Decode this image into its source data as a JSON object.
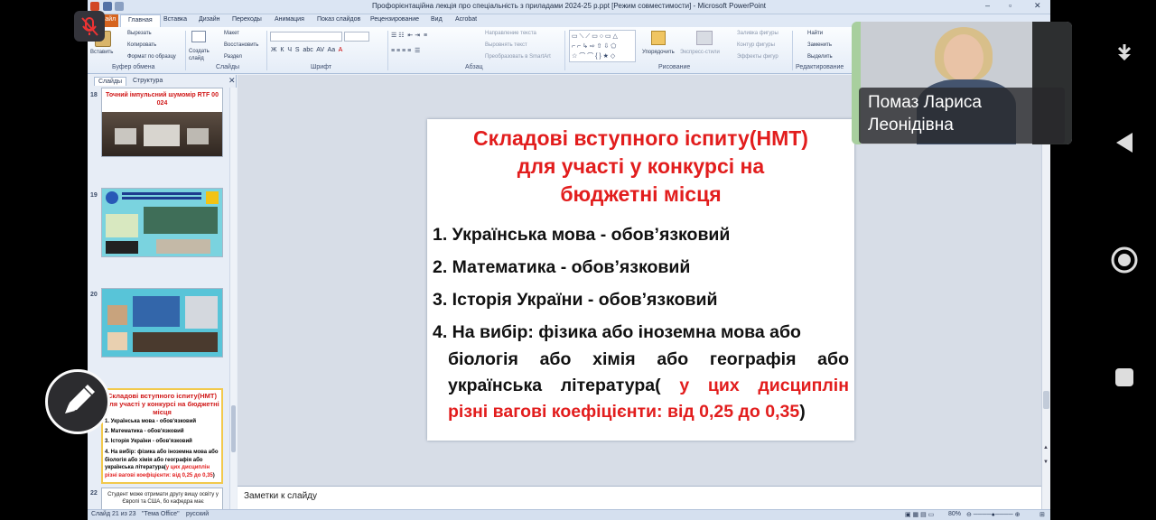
{
  "window": {
    "title": "Профорієнтаційна лекція про  спеціальність з приладами 2024-25 р.ppt [Режим совместимости] - Microsoft PowerPoint"
  },
  "ribbon_tabs": [
    "Файл",
    "Главная",
    "Вставка",
    "Дизайн",
    "Переходы",
    "Анимация",
    "Показ слайдов",
    "Рецензирование",
    "Вид",
    "Acrobat"
  ],
  "ribbon": {
    "clipboard": {
      "paste": "Вставить",
      "cut": "Вырезать",
      "copy": "Копировать",
      "format_painter": "Формат по образцу",
      "label": "Буфер обмена"
    },
    "slides": {
      "new_slide": "Создать слайд",
      "layout": "Макет",
      "reset": "Восстановить",
      "section": "Раздел",
      "label": "Слайды"
    },
    "font": {
      "label": "Шрифт"
    },
    "paragraph": {
      "text_direction": "Направление текста",
      "align_text": "Выровнять текст",
      "smartart": "Преобразовать в SmartArt",
      "label": "Абзац"
    },
    "drawing": {
      "arrange": "Упорядочить",
      "quick_styles": "Экспресс-стили",
      "fill": "Заливка фигуры",
      "outline": "Контур фигуры",
      "effects": "Эффекты фигур",
      "label": "Рисование"
    },
    "editing": {
      "find": "Найти",
      "replace": "Заменить",
      "select": "Выделить",
      "label": "Редактирование"
    }
  },
  "slides_panel": {
    "tabs": [
      "Слайды",
      "Структура"
    ],
    "thumbs": [
      {
        "num": "18",
        "title": "Точний імпульсний шумомір RTF 00 024"
      },
      {
        "num": "19"
      },
      {
        "num": "20"
      },
      {
        "num": "21",
        "title": "Складові вступного іспиту(НМТ) для участі у конкурсі на бюджетні місця",
        "items": [
          "1. Українська мова - обов'язковий",
          "2. Математика - обов'язковий",
          "3. Історія України - обов'язковий",
          "4. На вибір: фізика або іноземна мова або біологія або хімія або географія або українська література(",
          "у цих дисциплін різні вагові коефіцієнти: від 0,25 до 0,35",
          ")"
        ]
      },
      {
        "num": "22",
        "text": "Студент може отримати другу вищу освіту у Європі та США, бо кафедра має"
      }
    ]
  },
  "slide": {
    "title": [
      "Складові вступного іспиту(НМТ)",
      "для участі у конкурсі на",
      "бюджетні місця"
    ],
    "item1": "1. Українська мова - обов’язковий",
    "item2": "2. Математика  - обов’язковий",
    "item3": "3. Історія України - обов’язковий",
    "item4_line1": "4. На вибір: фізика або іноземна мова або",
    "item4_line2": "біологія або хімія або географія або",
    "item4_line3_black": "українська література(",
    "item4_line3_red": "у цих дисциплін",
    "item4_line4_red": "різні вагові коефіцієнти: від 0,25 до 0,35",
    "item4_line4_black": ")"
  },
  "notes": {
    "placeholder": "Заметки к слайду"
  },
  "status": {
    "slide_count": "Слайд 21 из 23",
    "theme": "\"Тема Office\"",
    "language": "русский",
    "zoom": "80%"
  },
  "participant": {
    "name_line1": "Помаз Лариса",
    "name_line2": "Леонідівна"
  }
}
